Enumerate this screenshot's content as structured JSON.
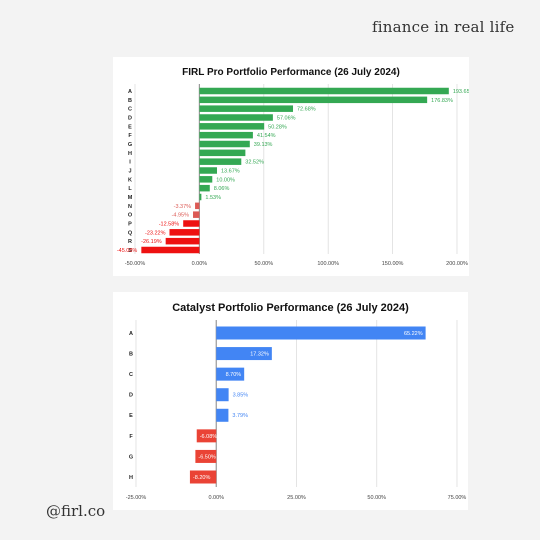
{
  "brand": "finance in real life",
  "handle": "@firl.co",
  "colors": {
    "positive": "#34a853",
    "negative_light": "#dc5a55",
    "negative": "#ee1111",
    "catalyst_positive": "#4285f4",
    "catalyst_negative": "#ea4335",
    "grid": "#dddddd",
    "axis": "#999999"
  },
  "chart_data": [
    {
      "type": "bar",
      "orientation": "horizontal",
      "title": "FIRL Pro Portfolio Performance (26 July 2024)",
      "categories": [
        "A",
        "B",
        "C",
        "D",
        "E",
        "F",
        "G",
        "H",
        "I",
        "J",
        "K",
        "L",
        "M",
        "N",
        "O",
        "P",
        "Q",
        "R",
        "S"
      ],
      "values": [
        193.65,
        176.83,
        72.68,
        57.06,
        50.28,
        41.54,
        39.13,
        35.7,
        32.52,
        13.67,
        10.0,
        8.06,
        1.53,
        -3.37,
        -4.95,
        -12.58,
        -23.22,
        -26.19,
        -45.08
      ],
      "labels": [
        "193.65%",
        "176.83%",
        "72.68%",
        "57.06%",
        "50.28%",
        "41.54%",
        "39.13%",
        "",
        "32.52%",
        "13.67%",
        "10.00%",
        "8.06%",
        "1.53%",
        "-3.37%",
        "-4.95%",
        "-12.58%",
        "-23.22%",
        "-26.19%",
        "-45.08%"
      ],
      "xticks": [
        -50,
        0,
        50,
        100,
        150,
        200
      ],
      "xtick_labels": [
        "-50.00%",
        "0.00%",
        "50.00%",
        "100.00%",
        "150.00%",
        "200.00%"
      ],
      "xlim": [
        -50,
        200
      ],
      "grid": true,
      "xlabel": "",
      "ylabel": ""
    },
    {
      "type": "bar",
      "orientation": "horizontal",
      "title": "Catalyst Portfolio Performance (26 July 2024)",
      "categories": [
        "A",
        "B",
        "C",
        "D",
        "E",
        "F",
        "G",
        "H"
      ],
      "values": [
        65.22,
        17.32,
        8.7,
        3.85,
        3.79,
        -6.08,
        -6.5,
        -8.2
      ],
      "labels": [
        "65.22%",
        "17.32%",
        "8.70%",
        "3.85%",
        "3.79%",
        "-6.08%",
        "-6.50%",
        "-8.20%"
      ],
      "xticks": [
        -25,
        0,
        25,
        50,
        75
      ],
      "xtick_labels": [
        "-25.00%",
        "0.00%",
        "25.00%",
        "50.00%",
        "75.00%"
      ],
      "xlim": [
        -25,
        75
      ],
      "grid": true,
      "xlabel": "",
      "ylabel": ""
    }
  ]
}
